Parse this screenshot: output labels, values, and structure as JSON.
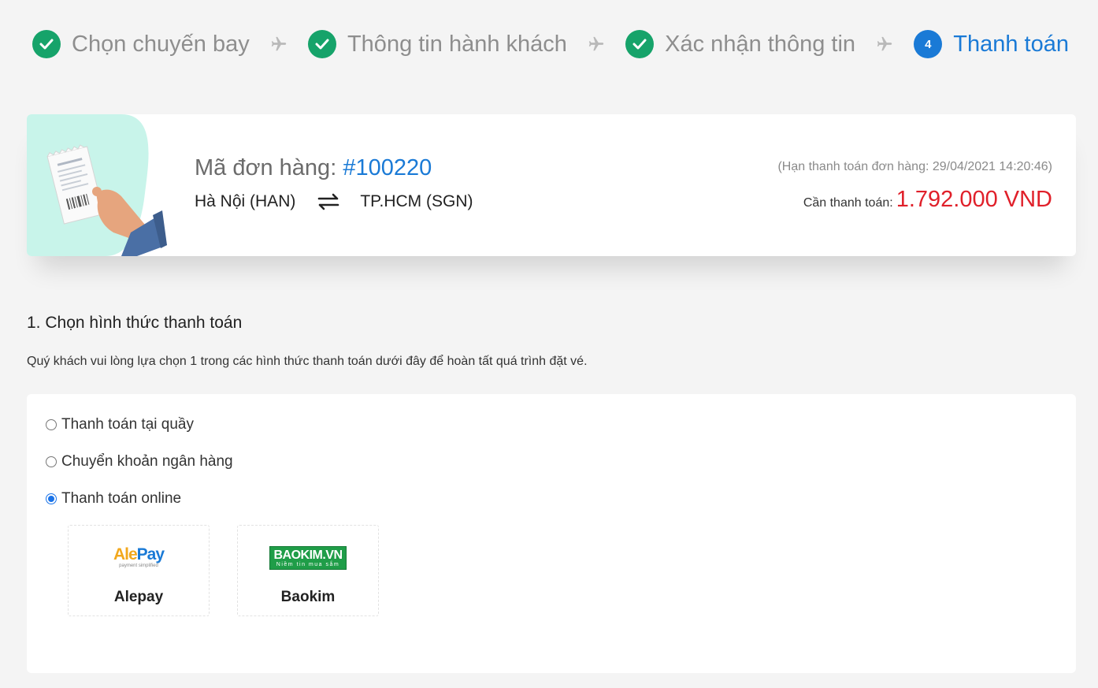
{
  "steps": [
    {
      "label": "Chọn chuyến bay",
      "status": "done",
      "icon": "check-icon"
    },
    {
      "label": "Thông tin hành khách",
      "status": "done",
      "icon": "check-icon"
    },
    {
      "label": "Xác nhận thông tin",
      "status": "done",
      "icon": "check-icon"
    },
    {
      "label": "Thanh toán",
      "status": "active",
      "number": "4"
    }
  ],
  "order": {
    "code_label": "Mã đơn hàng:",
    "code": "#100220",
    "origin": "Hà Nội (HAN)",
    "destination": "TP.HCM (SGN)",
    "deadline": "(Hạn thanh toán đơn hàng: 29/04/2021 14:20:46)",
    "due_label": "Cần thanh toán:",
    "due_amount": "1.792.000 VND"
  },
  "payment": {
    "section_title": "1. Chọn hình thức thanh toán",
    "description": "Quý khách vui lòng lựa chọn 1 trong các hình thức thanh toán dưới đây để hoàn tất quá trình đặt vé.",
    "options": [
      {
        "label": "Thanh toán tại quầy",
        "checked": false
      },
      {
        "label": "Chuyển khoản ngân hàng",
        "checked": false
      },
      {
        "label": "Thanh toán online",
        "checked": true
      }
    ],
    "providers": [
      {
        "name": "Alepay",
        "logo_text_1": "Ale",
        "logo_text_2": "Pay",
        "logo_sub": "payment simplified"
      },
      {
        "name": "Baokim",
        "logo_text": "BAOKIM.VN",
        "logo_sub": "Niềm tin mua sắm"
      }
    ]
  },
  "colors": {
    "accent": "#1a7ad6",
    "done": "#16a36a",
    "price": "#e0202a"
  }
}
